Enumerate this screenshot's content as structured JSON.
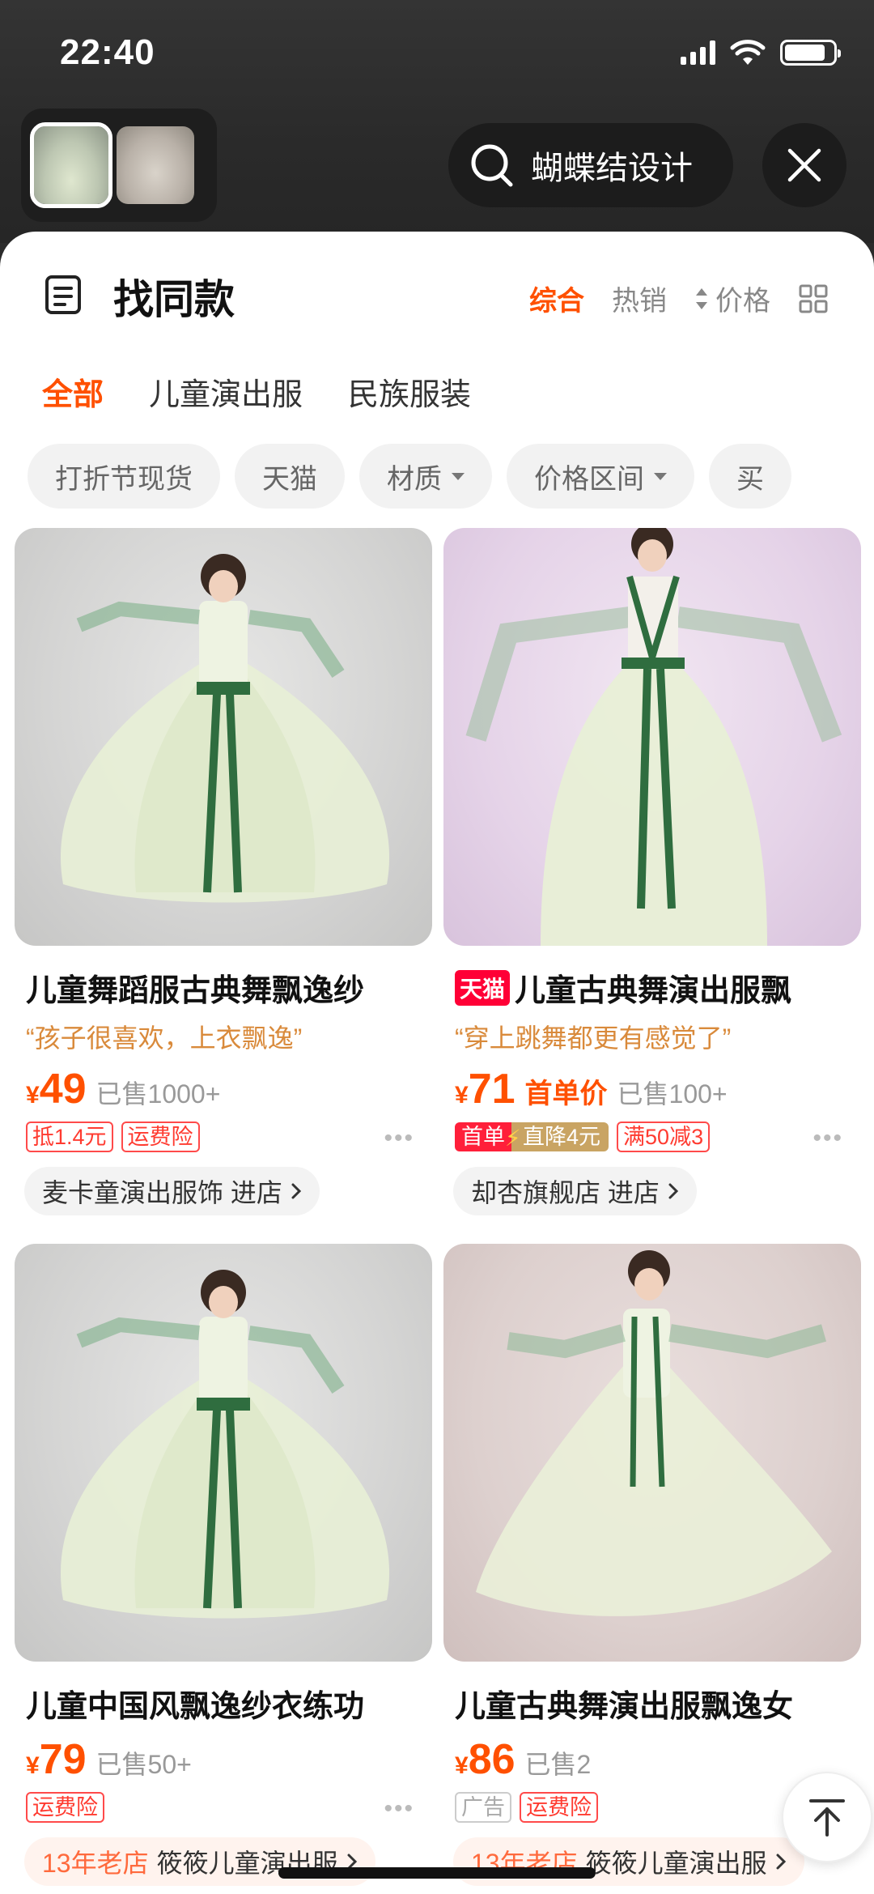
{
  "status_bar": {
    "time": "22:40"
  },
  "header": {
    "search_text": "蝴蝶结设计"
  },
  "sheet": {
    "title": "找同款",
    "sort_tabs": [
      "综合",
      "热销",
      "价格"
    ],
    "category_tabs": [
      "全部",
      "儿童演出服",
      "民族服装"
    ],
    "filters": [
      "打折节现货",
      "天猫",
      "材质",
      "价格区间",
      "买"
    ]
  },
  "products": [
    {
      "title": "儿童舞蹈服古典舞飘逸纱",
      "quote": "“孩子很喜欢，上衣飘逸”",
      "currency": "¥",
      "price": "49",
      "sold": "已售1000+",
      "tags": [
        "抵1.4元",
        "运费险"
      ],
      "shop": "麦卡童演出服饰 进店"
    },
    {
      "tmall": "天猫",
      "title": "儿童古典舞演出服飘",
      "quote": "“穿上跳舞都更有感觉了”",
      "currency": "¥",
      "price": "71",
      "price_note": "首单价",
      "sold": "已售100+",
      "tag_first": "首单",
      "tag_drop": "直降4元",
      "tag_coupon": "满50减3",
      "shop": "却杏旗舰店 进店"
    },
    {
      "title": "儿童中国风飘逸纱衣练功",
      "currency": "¥",
      "price": "79",
      "sold": "已售50+",
      "tags": [
        "运费险"
      ],
      "shop_old": "13年老店",
      "shop": "筱筱儿童演出服"
    },
    {
      "title": "儿童古典舞演出服飘逸女",
      "currency": "¥",
      "price": "86",
      "sold": "已售2",
      "ad_tag": "广告",
      "tags": [
        "运费险"
      ],
      "shop_old": "13年老店",
      "shop": "筱筱儿童演出服"
    }
  ],
  "icons": [
    "search-icon",
    "close-icon",
    "doc-icon",
    "grid-view-icon",
    "sort-arrows-icon",
    "back-to-top-icon",
    "chevron-right-icon"
  ]
}
